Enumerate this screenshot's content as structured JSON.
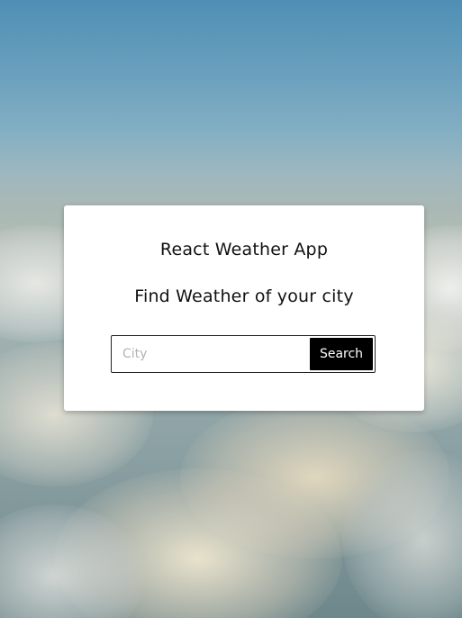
{
  "app": {
    "title": "React Weather App",
    "subtitle": "Find Weather of your city"
  },
  "search": {
    "placeholder": "City",
    "value": "",
    "button_label": "Search"
  },
  "colors": {
    "card_background": "#ffffff",
    "button_background": "#000000",
    "button_text": "#ffffff",
    "text": "#111111"
  }
}
